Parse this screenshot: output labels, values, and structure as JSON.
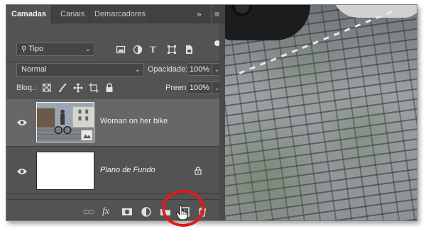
{
  "tabs": [
    {
      "label": "Camadas"
    },
    {
      "label": "Canais"
    },
    {
      "label": "Demarcadores"
    }
  ],
  "tab_controls": {
    "collapse": "»",
    "menu": "≡"
  },
  "filter": {
    "kind": "Tipo"
  },
  "blend": {
    "mode": "Normal",
    "opacity_label": "Opacidade:",
    "opacity_value": "100%"
  },
  "lock": {
    "label": "Bloq.:",
    "fill_label": "Preen.:",
    "fill_value": "100%"
  },
  "layers": [
    {
      "name": "Woman on her bike",
      "selected": true
    },
    {
      "name": "Plano de Fundo",
      "selected": false,
      "locked": true
    }
  ],
  "colors": {
    "highlight": "#e01b1b",
    "panel": "#535353",
    "selected_row": "#676767"
  },
  "icons": {
    "filter_icons": [
      "pixel-filter-icon",
      "adjustment-filter-icon",
      "type-filter-icon",
      "shape-filter-icon",
      "smart-object-filter-icon"
    ],
    "lock_icons": [
      "lock-transparent-icon",
      "lock-paint-icon",
      "lock-position-icon",
      "lock-artboard-icon",
      "lock-all-icon"
    ],
    "bottom_icons": [
      "link-icon",
      "fx-icon",
      "mask-icon",
      "adjustment-icon",
      "group-icon",
      "new-layer-icon",
      "trash-icon"
    ]
  }
}
